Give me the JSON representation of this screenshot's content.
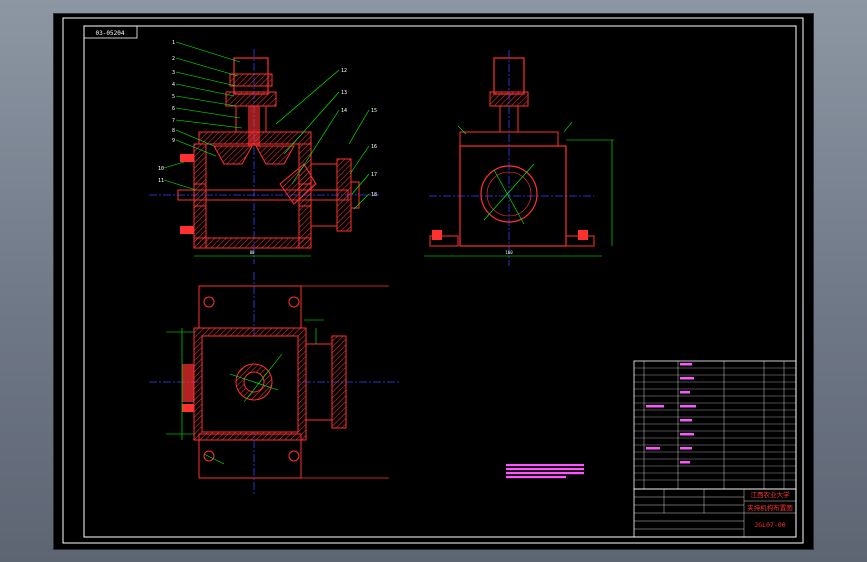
{
  "viewport": {
    "background": "#000000",
    "frame_color": "#ffffff",
    "outline_color": "#ff2020",
    "leader_color": "#00ff00",
    "dimension_color": "#00ff00",
    "centerline_color": "#3344ff",
    "hatch_color": "#ff3333",
    "note_color": "#ff55ff"
  },
  "drawing": {
    "corner_stamp": "03-05204",
    "front_view_part_numbers": [
      "1",
      "2",
      "3",
      "4",
      "5",
      "6",
      "7",
      "8",
      "9",
      "10",
      "11",
      "12",
      "13",
      "14",
      "15",
      "16",
      "17",
      "18"
    ],
    "side_view_dimension_bottom": "160",
    "title_block": {
      "school": "江西农业大学",
      "drawing_name": "夹持机构布置图",
      "drawing_number": "JGL07-00"
    }
  }
}
